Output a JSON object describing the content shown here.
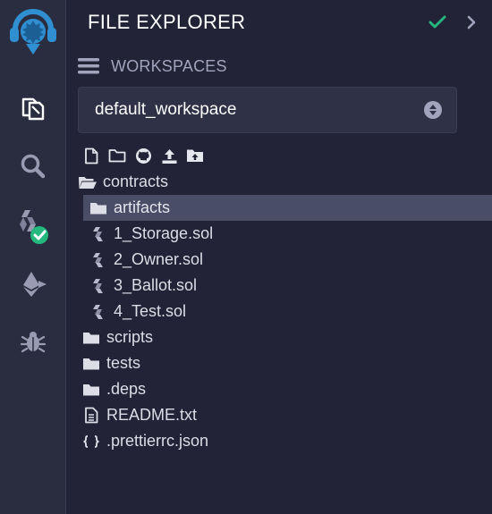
{
  "rail": {
    "items": [
      {
        "icon": "remix-logo-icon"
      },
      {
        "icon": "file-explorer-icon"
      },
      {
        "icon": "search-icon"
      },
      {
        "icon": "solidity-compiler-icon"
      },
      {
        "icon": "ethereum-deploy-icon"
      },
      {
        "icon": "debugger-icon"
      }
    ]
  },
  "header": {
    "title": "FILE EXPLORER"
  },
  "workspaces": {
    "label": "WORKSPACES",
    "selected": "default_workspace"
  },
  "colors": {
    "accent": "#24b77e",
    "background": "#222336",
    "rail": "#2a2c3f",
    "selected_row": "#4a4d66",
    "muted": "#a2a3bd"
  },
  "tree": [
    {
      "label": "contracts",
      "icon": "folder-open-icon",
      "indent": 0
    },
    {
      "label": "artifacts",
      "icon": "folder-icon",
      "indent": 1,
      "selected": true
    },
    {
      "label": "1_Storage.sol",
      "icon": "solidity-file-icon",
      "indent": 1
    },
    {
      "label": "2_Owner.sol",
      "icon": "solidity-file-icon",
      "indent": 1
    },
    {
      "label": "3_Ballot.sol",
      "icon": "solidity-file-icon",
      "indent": 1
    },
    {
      "label": "4_Test.sol",
      "icon": "solidity-file-icon",
      "indent": 1
    },
    {
      "label": "scripts",
      "icon": "folder-icon",
      "indent": 0
    },
    {
      "label": "tests",
      "icon": "folder-icon",
      "indent": 0
    },
    {
      "label": ".deps",
      "icon": "folder-icon",
      "indent": 0
    },
    {
      "label": "README.txt",
      "icon": "text-file-icon",
      "indent": 0
    },
    {
      "label": ".prettierrc.json",
      "icon": "json-file-icon",
      "indent": 0
    }
  ]
}
